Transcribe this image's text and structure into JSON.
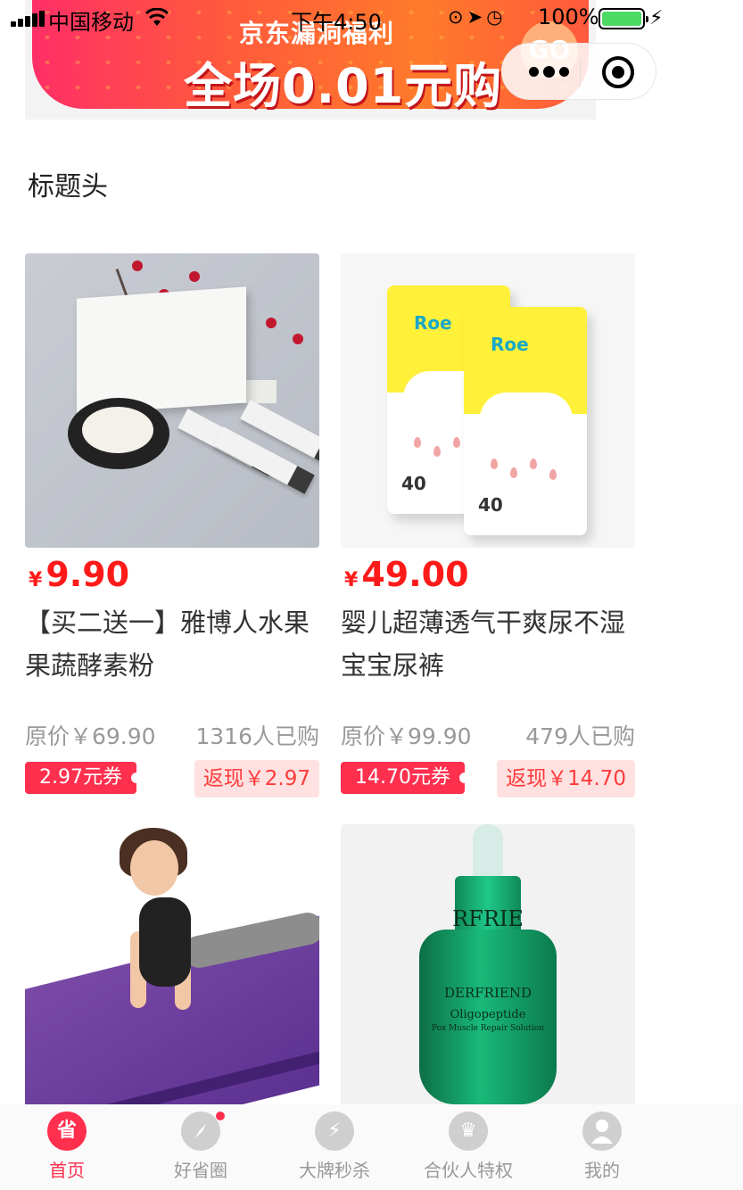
{
  "status_bar": {
    "carrier": "中国移动",
    "time": "下午4:50",
    "battery": "100%",
    "wifi_icon": "wifi-icon",
    "battery_color": "#4cd964"
  },
  "banner": {
    "subtitle": "京东漏洞福利",
    "headline": "全场0.01元购",
    "go_label": "GO"
  },
  "section": {
    "title": "标题头"
  },
  "products": [
    {
      "currency": "¥",
      "price": "9.90",
      "title": "【买二送一】雅博人水果果蔬酵素粉",
      "original_price": "原价￥69.90",
      "sold": "1316人已购",
      "coupon": "2.97元券",
      "cashback": "返现￥2.97",
      "image": "enzyme-powder-image"
    },
    {
      "currency": "¥",
      "price": "49.00",
      "title": "婴儿超薄透气干爽尿不湿宝宝尿裤",
      "original_price": "原价￥99.90",
      "sold": "479人已购",
      "coupon": "14.70元券",
      "cashback": "返现￥14.70",
      "image": "diaper-image",
      "image_text": {
        "logo": "Roe",
        "count": "40"
      }
    },
    {
      "image": "yoga-mat-image"
    },
    {
      "image": "serum-image",
      "image_text": {
        "brand_top": "RFRIE",
        "brand": "DERFRIEND",
        "product": "Oligopeptide",
        "desc": "Pox Muscle Repair Solution"
      }
    }
  ],
  "tabbar": {
    "items": [
      {
        "label": "首页",
        "icon": "省",
        "active": true
      },
      {
        "label": "好省圈",
        "icon": "compass-icon"
      },
      {
        "label": "大牌秒杀",
        "icon": "alarm-clock-icon"
      },
      {
        "label": "合伙人特权",
        "icon": "crown-icon"
      },
      {
        "label": "我的",
        "icon": "person-icon"
      }
    ]
  },
  "colors": {
    "accent": "#ff2f4e",
    "price": "#ff1a1a",
    "cashback_bg": "#ffe1e1"
  }
}
